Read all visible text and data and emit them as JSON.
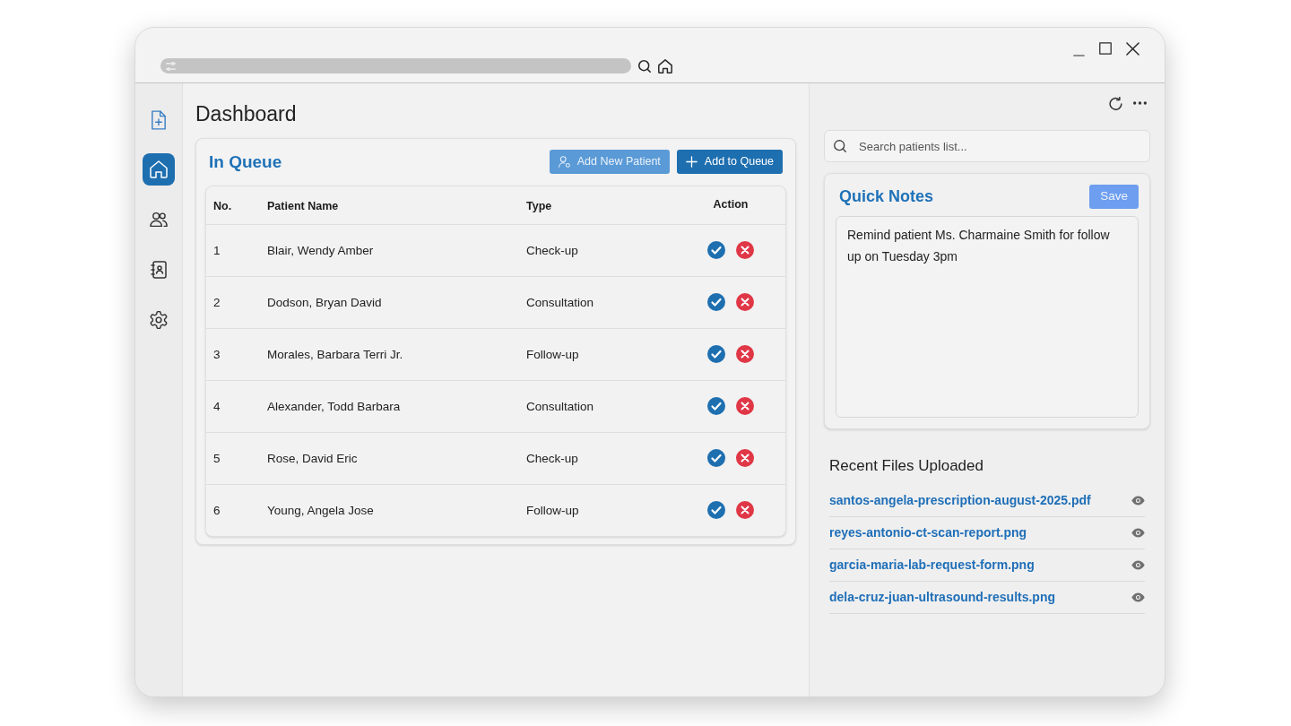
{
  "sidebar": {
    "items": [
      {
        "selected": true
      },
      {
        "selected": false
      },
      {
        "selected": false
      },
      {
        "selected": false
      }
    ]
  },
  "page_title": "Dashboard",
  "queue": {
    "title": "In Queue",
    "buttons": [
      {
        "label": "Add New Patient",
        "disabled": true
      },
      {
        "label": "Add to Queue",
        "disabled": false
      }
    ],
    "table": {
      "columns": [
        "No.",
        "Patient Name",
        "Type",
        "Action"
      ],
      "rows": [
        {
          "no": "1",
          "patient_name": "Blair, Wendy Amber",
          "type": "Check-up"
        },
        {
          "no": "2",
          "patient_name": "Dodson, Bryan David",
          "type": "Consultation"
        },
        {
          "no": "3",
          "patient_name": "Morales, Barbara Terri Jr.",
          "type": "Follow-up"
        },
        {
          "no": "4",
          "patient_name": "Alexander, Todd Barbara",
          "type": "Consultation"
        },
        {
          "no": "5",
          "patient_name": "Rose, David Eric",
          "type": "Check-up"
        },
        {
          "no": "6",
          "patient_name": "Young, Angela Jose",
          "type": "Follow-up"
        }
      ]
    }
  },
  "search": {
    "placeholder": "Search patients list..."
  },
  "quick_notes": {
    "title": "Quick Notes",
    "save_button": {
      "label": "Save",
      "disabled": true
    },
    "value": "Remind patient Ms. Charmaine Smith for follow up on Tuesday 3pm"
  },
  "recent_files": {
    "title": "Recent Files Uploaded",
    "files": [
      "santos-angela-prescription-august-2025.pdf",
      "reyes-antonio-ct-scan-report.png",
      "garcia-maria-lab-request-form.png",
      "dela-cruz-juan-ultrasound-results.png"
    ]
  }
}
